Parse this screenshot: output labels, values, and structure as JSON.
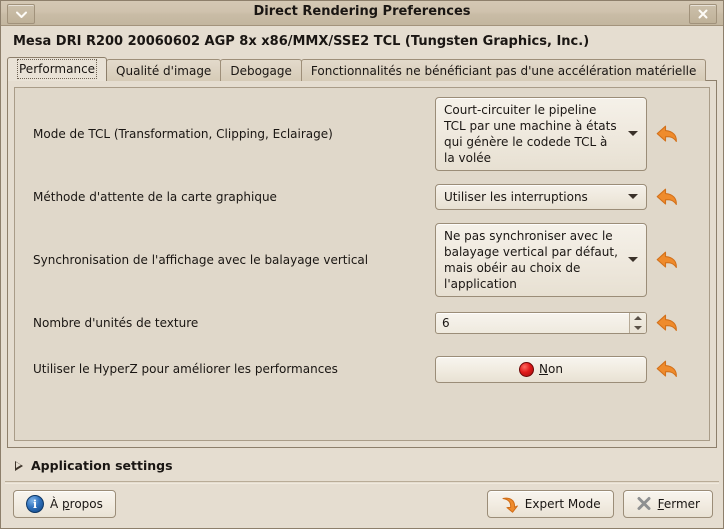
{
  "window": {
    "title": "Direct Rendering Preferences",
    "menu_button_icon": "chevron-down-icon",
    "close_button_icon": "close-icon",
    "close_button_glyph": "✕",
    "menu_button_glyph": "⌄"
  },
  "driver_header": "Mesa DRI R200 20060602 AGP 8x x86/MMX/SSE2 TCL (Tungsten Graphics, Inc.)",
  "tabs": [
    {
      "label": "Performance",
      "active": true
    },
    {
      "label": "Qualité d'image",
      "active": false
    },
    {
      "label": "Debogage",
      "active": false
    },
    {
      "label": "Fonctionnalités ne bénéficiant pas d'une accélération matérielle",
      "active": false
    }
  ],
  "options": [
    {
      "label": "Mode de TCL (Transformation, Clipping, Eclairage)",
      "control": "combo",
      "value": "Court-circuiter le pipeline TCL par une machine à états qui génère le codede TCL à la volée",
      "revert_icon": "undo-arrow-icon"
    },
    {
      "label": "Méthode d'attente de la carte graphique",
      "control": "combo",
      "value": "Utiliser les interruptions",
      "revert_icon": "undo-arrow-icon"
    },
    {
      "label": "Synchronisation de l'affichage avec le balayage vertical",
      "control": "combo",
      "value": "Ne pas synchroniser avec le balayage vertical par défaut, mais obéir au choix de l'application",
      "revert_icon": "undo-arrow-icon"
    },
    {
      "label": "Nombre d'unités de texture",
      "control": "spin",
      "value": "6",
      "revert_icon": "undo-arrow-icon"
    },
    {
      "label": "Utiliser le HyperZ pour améliorer les performances",
      "control": "toggle",
      "value": "Non",
      "value_mnemonic": "N",
      "value_rest": "on",
      "led_color": "#e01a1a",
      "revert_icon": "undo-arrow-icon"
    }
  ],
  "expander": {
    "label": "Application settings",
    "icon": "expander-triangle-icon",
    "expanded": false
  },
  "buttons": {
    "about": {
      "label": "À ",
      "mnemonic": "p",
      "rest": "ropos",
      "icon": "info-icon",
      "glyph": "i"
    },
    "expert_mode": {
      "label": "Expert Mode",
      "icon": "expert-arrow-icon"
    },
    "close": {
      "label": "F",
      "mnemonic": "F",
      "rest": "ermer",
      "icon": "close-x-icon"
    }
  },
  "colors": {
    "window_bg": "#e5ddd0",
    "titlebar": "#cfc2ad",
    "accent_orange": "#ef8b2c",
    "frame_border": "#8d7f6b"
  }
}
